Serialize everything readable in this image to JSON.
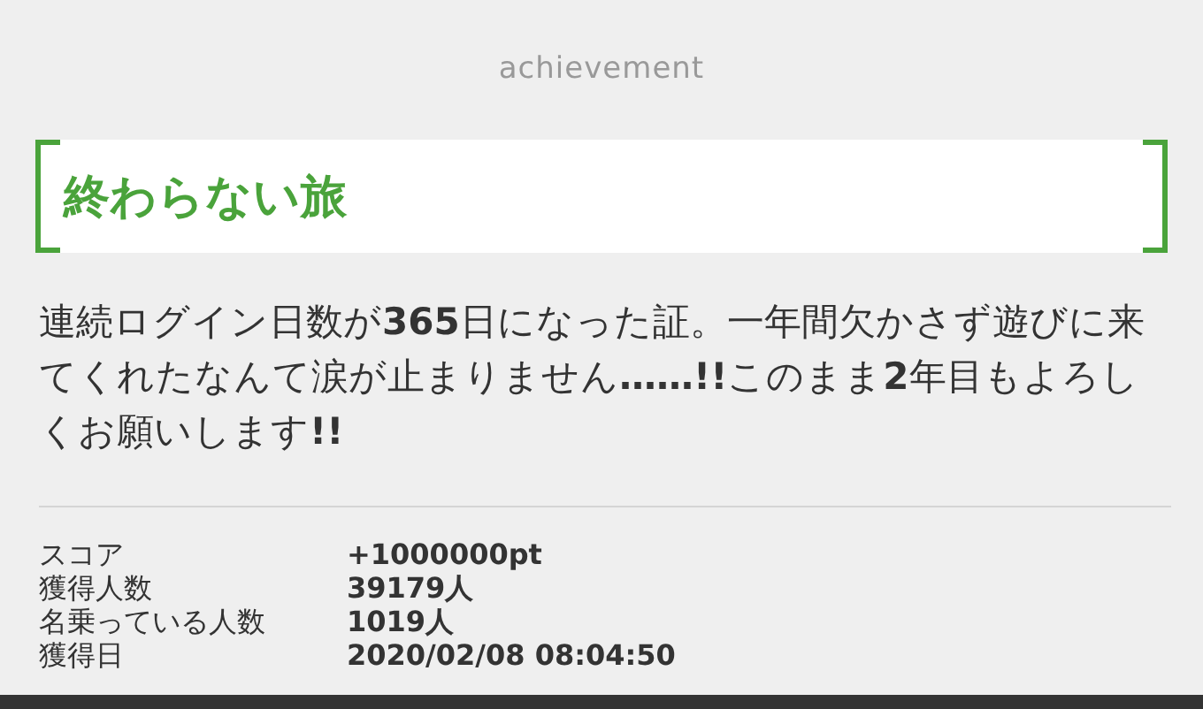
{
  "header": {
    "title": "achievement"
  },
  "achievement": {
    "name": "終わらない旅",
    "description": "連続ログイン日数が**365**日になった証。一年間欠かさず遊びに来てくれたなんて涙が止まりません**……!!**このまま**2**年目もよろしくお願いします**!!**"
  },
  "stats": [
    {
      "label": "スコア",
      "value": "+1000000pt"
    },
    {
      "label": "獲得人数",
      "value": "39179人"
    },
    {
      "label": "名乗っている人数",
      "value": "1019人"
    },
    {
      "label": "獲得日",
      "value": "2020/02/08 08:04:50"
    }
  ]
}
